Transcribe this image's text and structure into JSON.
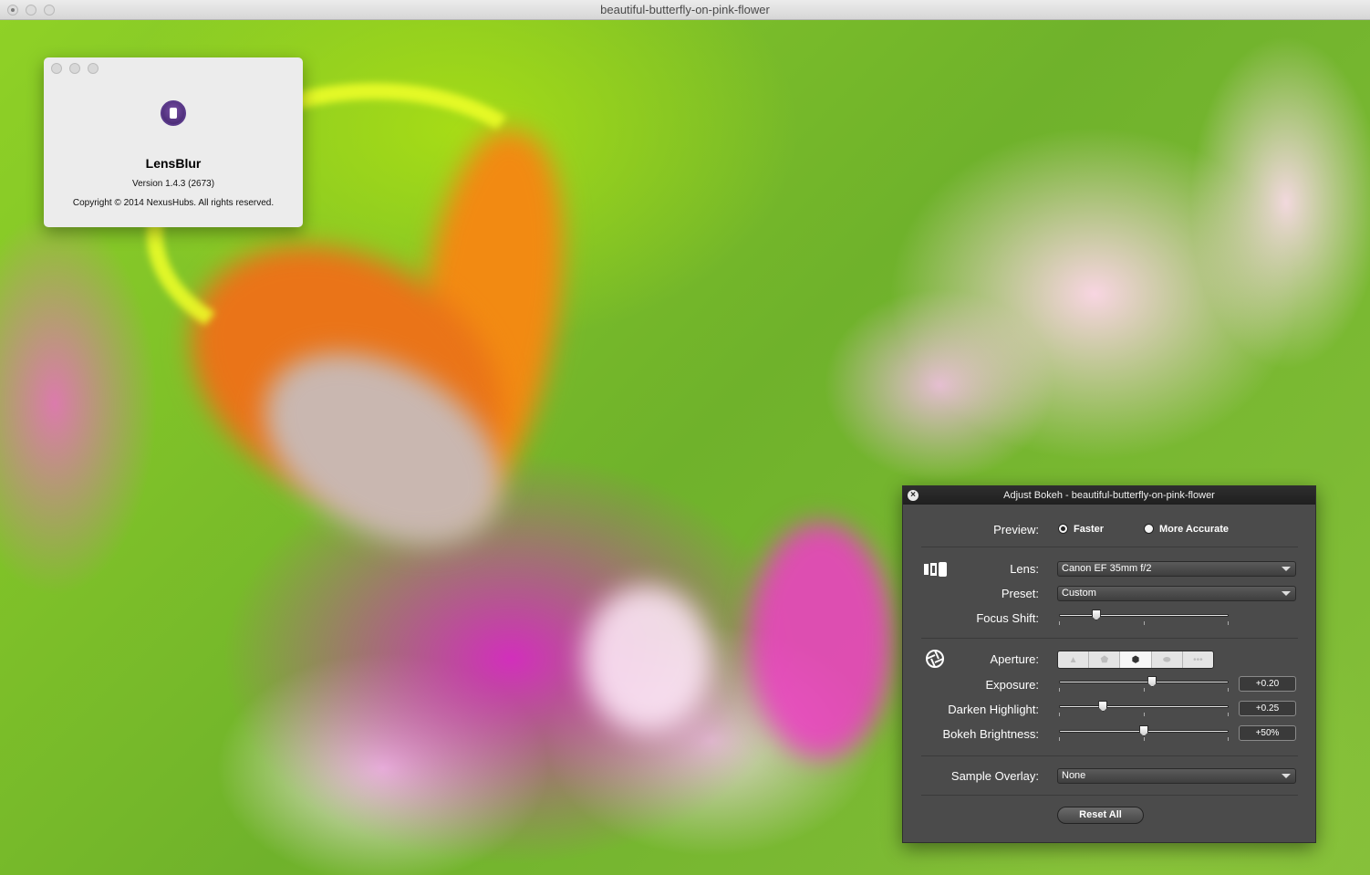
{
  "window": {
    "title": "beautiful-butterfly-on-pink-flower"
  },
  "about": {
    "app_name": "LensBlur",
    "version": "Version 1.4.3 (2673)",
    "copyright": "Copyright © 2014 NexusHubs. All rights reserved."
  },
  "panel": {
    "title": "Adjust Bokeh - beautiful-butterfly-on-pink-flower",
    "preview_label": "Preview:",
    "preview_options": [
      "Faster",
      "More Accurate"
    ],
    "preview_selected": "Faster",
    "lens_label": "Lens:",
    "lens_value": "Canon EF 35mm f/2",
    "preset_label": "Preset:",
    "preset_value": "Custom",
    "focus_shift_label": "Focus Shift:",
    "focus_shift_level": 0.22,
    "aperture_label": "Aperture:",
    "aperture_shapes": [
      "triangle",
      "pentagon",
      "hexagon",
      "ellipse",
      "dots"
    ],
    "aperture_selected": "hexagon",
    "exposure_label": "Exposure:",
    "exposure_value": "+0.20",
    "exposure_level": 0.55,
    "darken_label": "Darken Highlight:",
    "darken_value": "+0.25",
    "darken_level": 0.26,
    "bokeh_brightness_label": "Bokeh Brightness:",
    "bokeh_brightness_value": "+50%",
    "bokeh_brightness_level": 0.5,
    "overlay_label": "Sample Overlay:",
    "overlay_value": "None",
    "reset_label": "Reset All"
  },
  "icons": {
    "lens": "lens-icon",
    "aperture": "aperture-icon",
    "app": "lensblur-app-icon"
  }
}
